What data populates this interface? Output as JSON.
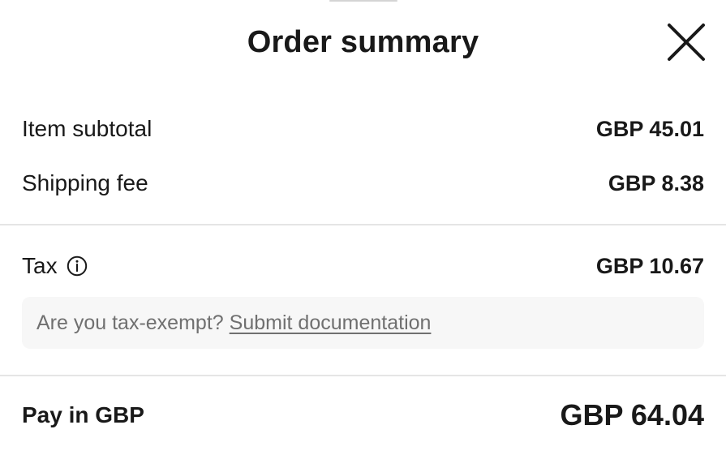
{
  "header": {
    "title": "Order summary",
    "close_icon": "close-icon"
  },
  "summary": {
    "item_subtotal_label": "Item subtotal",
    "item_subtotal_value": "GBP 45.01",
    "shipping_fee_label": "Shipping fee",
    "shipping_fee_value": "GBP 8.38",
    "tax_label": "Tax",
    "tax_info_icon": "info-icon",
    "tax_value": "GBP 10.67"
  },
  "tax_exempt": {
    "prompt": "Are you tax-exempt?",
    "link_label": "Submit documentation"
  },
  "total": {
    "label": "Pay in GBP",
    "value": "GBP 64.04"
  },
  "colors": {
    "text_primary": "#191919",
    "text_secondary": "#707070",
    "divider": "#e5e5e5",
    "panel_background": "#f7f7f7"
  }
}
